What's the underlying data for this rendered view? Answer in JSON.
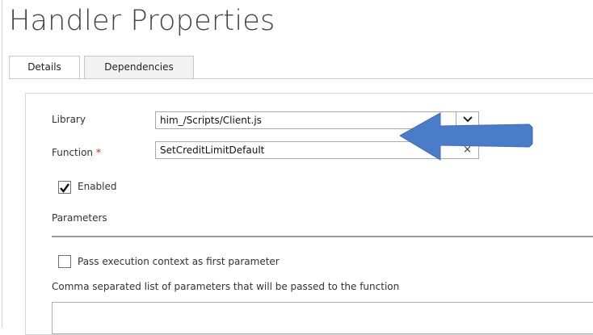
{
  "page": {
    "title": "Handler Properties"
  },
  "tabs": [
    {
      "label": "Details",
      "active": true
    },
    {
      "label": "Dependencies",
      "active": false
    }
  ],
  "form": {
    "library_label": "Library",
    "library_value": "him_/Scripts/Client.js",
    "function_label": "Function",
    "required_marker": "*",
    "function_value": "SetCreditLimitDefault",
    "clear_symbol": "×",
    "enabled_label": "Enabled",
    "enabled_checked": true,
    "parameters_heading": "Parameters",
    "pass_context_label": "Pass execution context as first parameter",
    "pass_context_checked": false,
    "params_list_label": "Comma separated list of parameters that will be passed to the function",
    "params_list_value": ""
  },
  "annotation": {
    "icon": "left-arrow-icon",
    "color": "#4a7cc7"
  }
}
